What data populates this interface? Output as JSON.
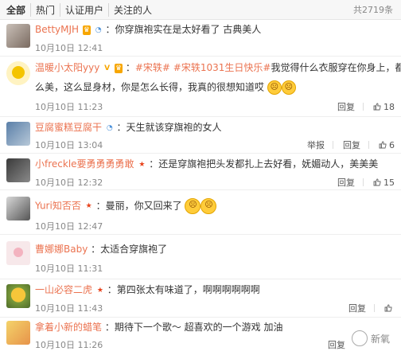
{
  "tabs": {
    "all": "全部",
    "hot": "热门",
    "verified": "认证用户",
    "following": "关注的人",
    "count": "共2719条"
  },
  "actions": {
    "report": "举报",
    "reply": "回复"
  },
  "comments": [
    {
      "user": "BettyMJH",
      "content": "：你穿旗袍实在是太好看了 古典美人",
      "time": "10月10日 12:41",
      "likes": ""
    },
    {
      "user": "温暖小太阳yyy",
      "hashtags": "#宋轶# #宋轶1031生日快乐#",
      "content": "我觉得什么衣服穿在你身上，都这么美，这么显身材，你是怎么长得，我真的很想知道哎",
      "content_line2": "么美，这么显身材，你是怎么长得，我真的很想知道哎",
      "time": "10月10日 11:23",
      "likes": "18"
    },
    {
      "user": "豆腐蜜糕豆腐干",
      "content": "：天生就该穿旗袍的女人",
      "time": "10月10日 13:04",
      "likes": "6"
    },
    {
      "user": "小freckle要勇勇勇勇敢",
      "content": "：还是穿旗袍把头发都扎上去好看，妩媚动人，美美美",
      "time": "10月10日 12:32",
      "likes": "15"
    },
    {
      "user": "Yuri知否否",
      "content": "：曼丽，你又回来了",
      "time": "10月10日 12:47",
      "likes": ""
    },
    {
      "user": "曹娜娜Baby",
      "content": "：太适合穿旗袍了",
      "time": "10月10日 11:31",
      "likes": ""
    },
    {
      "user": "一山必容二虎",
      "content": "：第四张太有味道了，啊啊啊啊啊啊",
      "time": "10月10日 11:43",
      "likes": ""
    },
    {
      "user": "拿着小新的蜡笔",
      "content": "：期待下一个歌～ 超喜欢的一个游戏 加油",
      "time": "10月10日 11:26",
      "likes": ""
    }
  ],
  "watermark": "新氧",
  "colors": {
    "username": "#eb7350",
    "meta": "#888888",
    "accent": "#f7a600"
  },
  "icons": [
    "thumbs-up-icon",
    "vip-crown-icon",
    "star-badge-icon",
    "emoji-face-icon"
  ]
}
